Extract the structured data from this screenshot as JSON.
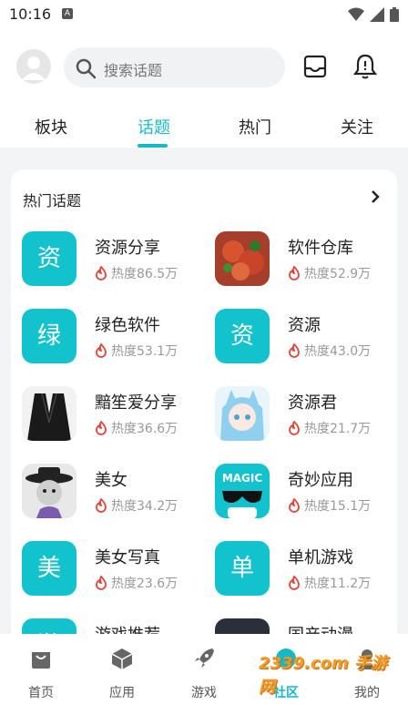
{
  "status": {
    "time": "10:16",
    "a_badge": "A"
  },
  "header": {
    "search_placeholder": "搜索话题"
  },
  "tabs": [
    {
      "label": "板块"
    },
    {
      "label": "话题"
    },
    {
      "label": "热门"
    },
    {
      "label": "关注"
    }
  ],
  "active_tab": "话题",
  "card": {
    "title": "热门话题",
    "topics": [
      {
        "name": "资源分享",
        "heat": "热度86.5万",
        "thumb_char": "资",
        "thumb": "teal"
      },
      {
        "name": "软件仓库",
        "heat": "热度52.9万",
        "thumb": "photo-food"
      },
      {
        "name": "绿色软件",
        "heat": "热度53.1万",
        "thumb_char": "绿",
        "thumb": "teal"
      },
      {
        "name": "资源",
        "heat": "热度43.0万",
        "thumb_char": "资",
        "thumb": "teal"
      },
      {
        "name": "黯笙爱分享",
        "heat": "热度36.6万",
        "thumb": "photo-suit"
      },
      {
        "name": "资源君",
        "heat": "热度21.7万",
        "thumb": "photo-anime"
      },
      {
        "name": "美女",
        "heat": "热度34.2万",
        "thumb": "photo-cat"
      },
      {
        "name": "奇妙应用",
        "heat": "热度15.1万",
        "thumb": "magic-logo",
        "thumb_text": "MAGIC"
      },
      {
        "name": "美女写真",
        "heat": "热度23.6万",
        "thumb_char": "美",
        "thumb": "teal"
      },
      {
        "name": "单机游戏",
        "heat": "热度11.2万",
        "thumb_char": "单",
        "thumb": "teal"
      },
      {
        "name": "游戏推荐",
        "heat": "",
        "thumb_char": "游",
        "thumb": "teal"
      },
      {
        "name": "国产动漫",
        "heat": "",
        "thumb": "photo-dark"
      }
    ]
  },
  "bottom_nav": [
    {
      "label": "首页",
      "icon": "home-bag-icon"
    },
    {
      "label": "应用",
      "icon": "cube-icon"
    },
    {
      "label": "游戏",
      "icon": "rocket-icon"
    },
    {
      "label": "社区",
      "icon": "community-icon"
    },
    {
      "label": "我的",
      "icon": "person-icon"
    }
  ],
  "watermark": "2339.com 手游网",
  "colors": {
    "accent": "#17b8c8",
    "teal_tile": "#12c2cc",
    "flame": "#e0453a"
  }
}
